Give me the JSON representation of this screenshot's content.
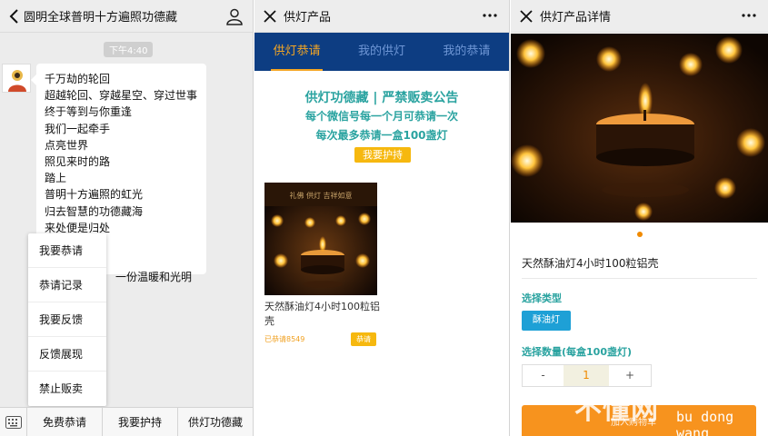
{
  "chat": {
    "title": "圆明全球普明十方遍照功德藏",
    "time": "下午4:40",
    "message_lines": [
      "千万劫的轮回",
      "超越轮回、穿越星空、穿过世事",
      "终于等到与你重逢",
      "我们一起牵手",
      "点亮世界",
      "照见来时的路",
      "踏上",
      "普明十方遍照的虹光",
      "归去智慧的功德藏海",
      "来处便是归处",
      "",
      "",
      "一份温暖和光明"
    ],
    "popup_menu": [
      "我要恭请",
      "恭请记录",
      "我要反馈",
      "反馈展现",
      "禁止贩卖"
    ],
    "bottom_menu": [
      "免费恭请",
      "我要护持",
      "供灯功德藏"
    ]
  },
  "shop": {
    "title": "供灯产品",
    "tabs": [
      "供灯恭请",
      "我的供灯",
      "我的恭请"
    ],
    "notice_title": "供灯功德藏 | 严禁贩卖公告",
    "notice_line1": "每个微信号每一个月可恭请一次",
    "notice_line2": "每次最多恭请一盒100盏灯",
    "protect_button": "我要护持",
    "product_name": "天然酥油灯4小时100粒铝壳",
    "product_count": "已恭请8549",
    "product_button": "恭请",
    "product_image_caption": "礼佛 供灯 吉祥如意"
  },
  "detail": {
    "title": "供灯产品详情",
    "product_name": "天然酥油灯4小时100粒铝壳",
    "type_label": "选择类型",
    "type_option": "酥油灯",
    "qty_label": "选择数量(每盒100盏灯)",
    "qty_minus": "-",
    "qty_value": "1",
    "qty_plus": "+"
  },
  "watermark": {
    "big": "不懂网",
    "small1": "爱分享",
    "small2": "bu dong wang",
    "small3": "加入购物车"
  },
  "colors": {
    "tab_bar": "#0d3d82",
    "accent_orange": "#f5a623",
    "teal_text": "#2aa3a0",
    "chip_blue": "#1ea0d6"
  }
}
